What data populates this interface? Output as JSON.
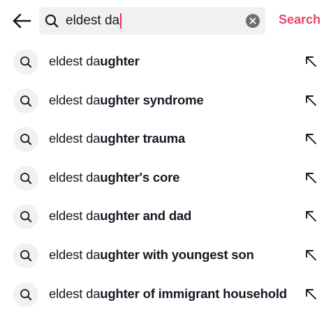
{
  "search": {
    "query": "eldest da",
    "submit_label": "Search"
  },
  "suggestions": [
    {
      "typed": "eldest da",
      "completion": "ughter"
    },
    {
      "typed": "eldest da",
      "completion": "ughter syndrome"
    },
    {
      "typed": "eldest da",
      "completion": "ughter trauma"
    },
    {
      "typed": "eldest da",
      "completion": "ughter's core"
    },
    {
      "typed": "eldest da",
      "completion": "ughter and dad"
    },
    {
      "typed": "eldest da",
      "completion": "ughter with youngest son"
    },
    {
      "typed": "eldest da",
      "completion": "ughter of immigrant household"
    }
  ],
  "icons": {
    "back": "back-arrow-icon",
    "search": "search-icon",
    "clear": "clear-icon",
    "fill": "arrow-up-left-icon"
  },
  "colors": {
    "accent": "#e8456a",
    "caret": "#e8345a",
    "field_background": "#f1f1f2",
    "text": "#161823"
  }
}
